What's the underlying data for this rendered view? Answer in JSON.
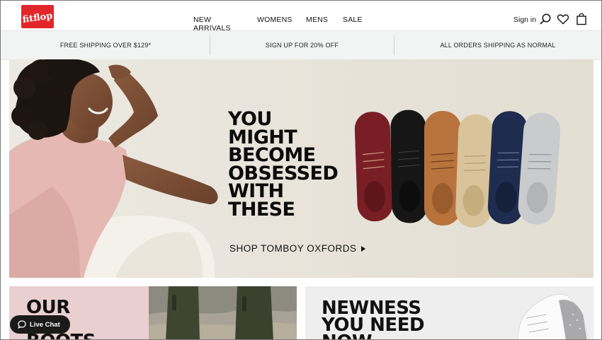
{
  "brand": {
    "logo_text": "fitflop"
  },
  "nav": {
    "items": [
      "NEW ARRIVALS",
      "WOMENS",
      "MENS",
      "SALE"
    ]
  },
  "account": {
    "signin_label": "Sign in"
  },
  "icons": {
    "search": "search-icon",
    "wishlist": "heart-icon",
    "bag": "shopping-bag-icon",
    "chat": "chat-bubble-icon"
  },
  "promo": [
    {
      "text": "FREE SHIPPING OVER $129*"
    },
    {
      "text": "SIGN UP FOR 20% OFF"
    },
    {
      "text": "ALL ORDERS SHIPPING AS NORMAL"
    }
  ],
  "hero": {
    "headline": [
      "YOU",
      "MIGHT",
      "BECOME",
      "OBSESSED",
      "WITH",
      "THESE"
    ],
    "cta_label": "SHOP TOMBOY OXFORDS",
    "shoe_colors": [
      "#7a1e26",
      "#161616",
      "#b8733d",
      "#d8c39b",
      "#1e2c4f",
      "#c9cbcd"
    ]
  },
  "tiles": {
    "left_title": [
      "OUR",
      "",
      "BOOTS"
    ],
    "right_title": [
      "NEWNESS",
      "YOU NEED",
      "NOW"
    ]
  },
  "chat": {
    "label": "Live Chat"
  },
  "colors": {
    "brand_red": "#e3262b",
    "hero_bg": "#e6e2d8",
    "promo_bg": "#f2f3f3",
    "tile_pink": "#e9cfd0"
  }
}
